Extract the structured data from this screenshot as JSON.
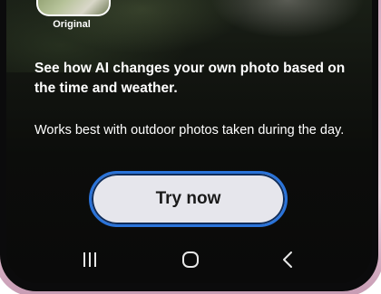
{
  "promo": {
    "thumbnail_label": "Original",
    "headline": "See how AI changes your own photo based on the time and weather.",
    "body": "Works best with outdoor photos taken during the day.",
    "cta_label": "Try now"
  },
  "navigation": {
    "recents_icon": "recents-icon",
    "home_icon": "home-icon",
    "back_icon": "back-icon"
  },
  "colors": {
    "button_border": "#2a73d9",
    "button_fill": "#e6e6ec",
    "phone_frame": "#e4c3d4",
    "screen_bg": "#0c0d0b"
  }
}
